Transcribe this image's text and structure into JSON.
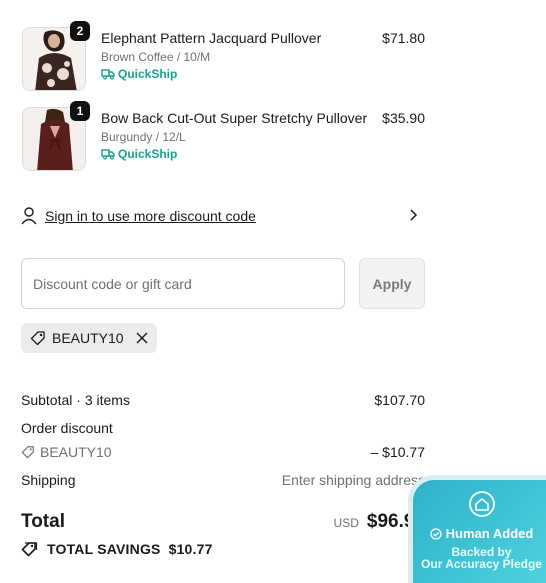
{
  "cart": {
    "items": [
      {
        "name": "Elephant Pattern Jacquard Pullover",
        "variant": "Brown Coffee / 10/M",
        "price": "$71.80",
        "quantity": "2",
        "shipping_tag": "QuickShip"
      },
      {
        "name": "Bow Back Cut-Out Super Stretchy Pullover",
        "variant": "Burgundy / 12/L",
        "price": "$35.90",
        "quantity": "1",
        "shipping_tag": "QuickShip"
      }
    ]
  },
  "signin": {
    "label": "Sign in to use more discount code"
  },
  "discount": {
    "placeholder": "Discount code or gift card",
    "value": "",
    "apply_label": "Apply",
    "applied_code": "BEAUTY10"
  },
  "summary": {
    "subtotal_label": "Subtotal · 3 items",
    "subtotal_value": "$107.70",
    "order_discount_label": "Order discount",
    "discount_code": "BEAUTY10",
    "discount_value": "– $10.77",
    "shipping_label": "Shipping",
    "shipping_value": "Enter shipping address",
    "total_label": "Total",
    "currency": "USD",
    "total_value": "$96.93",
    "savings_label": "TOTAL SAVINGS",
    "savings_value": "$10.77"
  },
  "pledge": {
    "title": "Human Added",
    "line1": "Backed by",
    "line2": "Our Accuracy Pledge"
  },
  "colors": {
    "quickship": "#1aa38a",
    "pledge_badge": "#3fc4d6",
    "chip_background": "#ebebeb"
  },
  "icons": [
    "truck-icon",
    "user-icon",
    "chevron-right-icon",
    "tag-icon",
    "close-icon",
    "savings-tag-icon",
    "shield-home-icon",
    "check-circle-icon"
  ]
}
